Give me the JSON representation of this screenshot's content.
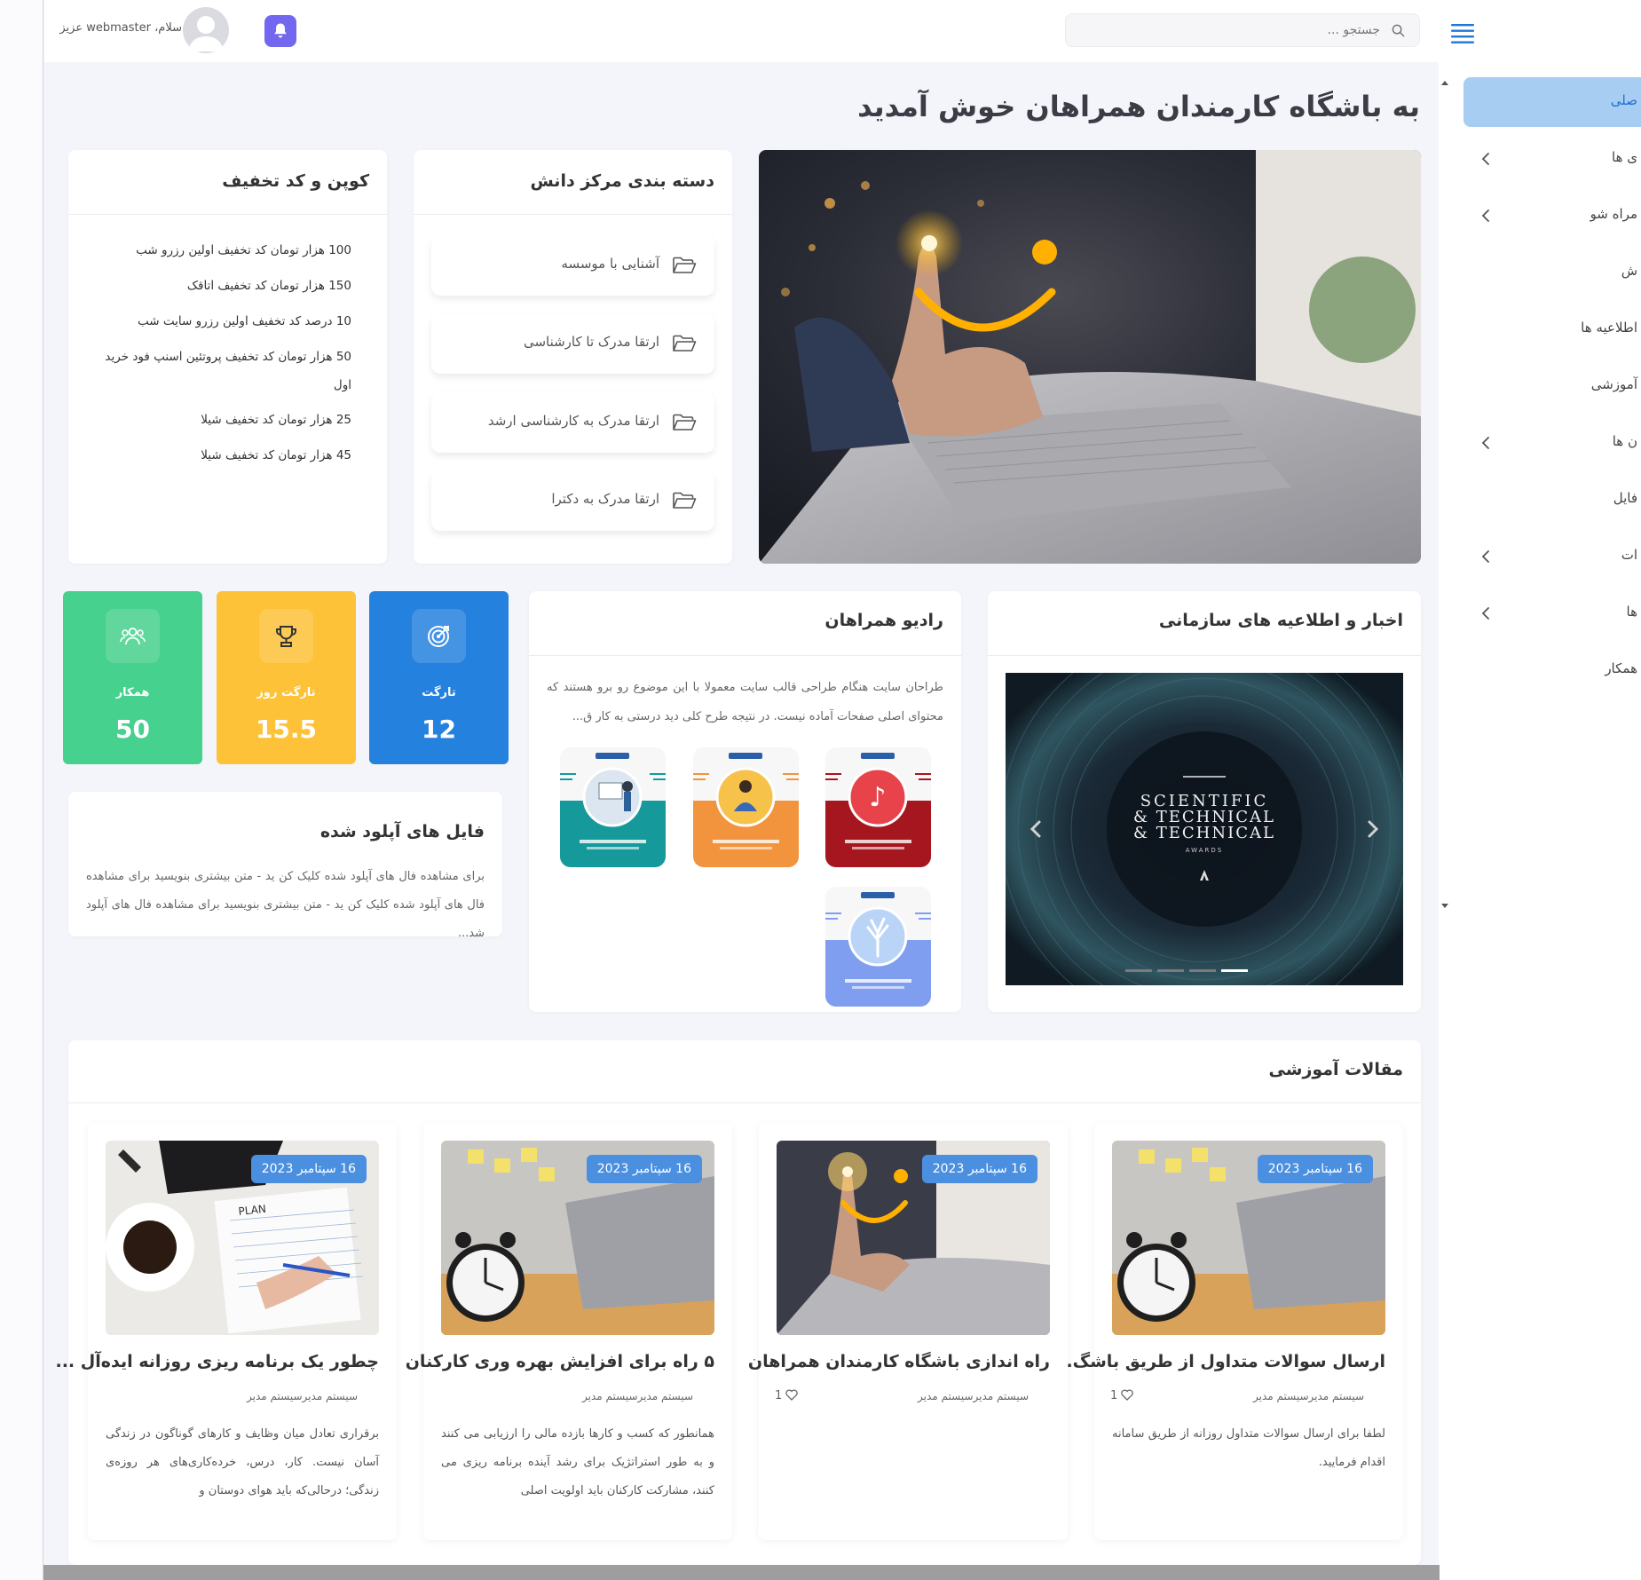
{
  "header": {
    "search_placeholder": "جستجو ...",
    "greeting": "سلام، webmaster عزیز"
  },
  "sidebar": {
    "items": [
      {
        "label": "صلی",
        "active": true,
        "has_chevron": false
      },
      {
        "label": "ی ها",
        "active": false,
        "has_chevron": true
      },
      {
        "label": "مراه شو",
        "active": false,
        "has_chevron": true
      },
      {
        "label": "ش",
        "active": false,
        "has_chevron": false
      },
      {
        "label": "اطلاعیه ها",
        "active": false,
        "has_chevron": false
      },
      {
        "label": "آموزشی",
        "active": false,
        "has_chevron": false
      },
      {
        "label": "ن ها",
        "active": false,
        "has_chevron": true
      },
      {
        "label": "فایل",
        "active": false,
        "has_chevron": false
      },
      {
        "label": "ات",
        "active": false,
        "has_chevron": true
      },
      {
        "label": "ها",
        "active": false,
        "has_chevron": true
      },
      {
        "label": "همکار",
        "active": false,
        "has_chevron": false
      }
    ]
  },
  "page": {
    "title": "به باشگاه کارمندان همراهان خوش آمدید"
  },
  "categories": {
    "title": "دسته بندی مرکز دانش",
    "items": [
      "آشنایی با موسسه",
      "ارتقا مدرک تا کارشناسی",
      "ارتقا مدرک به کارشناسی ارشد",
      "ارتقا مدرک به دکترا"
    ]
  },
  "coupons": {
    "title": "کوپن و کد تخفیف",
    "items": [
      "100 هزار تومان کد تخفیف اولین رزرو شب",
      "150 هزار تومان کد تخفیف اتاقک",
      "10 درصد کد تخفیف اولین رزرو سایت شب",
      "50 هزار تومان کد تخفیف پروتئین اسنپ فود خرید اول",
      "25 هزار تومان کد تخفیف شیلا",
      "45 هزار تومان کد تخفیف شیلا"
    ]
  },
  "news": {
    "title": "اخبار و اطلاعیه های سازمانی",
    "slide": {
      "line1": "SCIENTIFIC",
      "line2": "& TECHNICAL",
      "line3": "& TECHNICAL",
      "line4": "AWARDS"
    },
    "slide_count": 4,
    "active_slide": 4
  },
  "radio": {
    "title": "رادیو همراهان",
    "description": "طراحان سایت هنگام طراحی قالب سایت معمولا با این موضوع رو برو هستند که محتوای اصلی صفحات آماده نیست. در نتیجه طرح کلی دید درستی به کار ق..."
  },
  "stats": [
    {
      "label": "تارگت",
      "value": "12",
      "color": "#2581de",
      "icon": "target-icon"
    },
    {
      "label": "تارگت روز",
      "value": "15.5",
      "color": "#fdc238",
      "icon": "trophy-icon"
    },
    {
      "label": "همکار",
      "value": "50",
      "color": "#46d18e",
      "icon": "users-icon"
    }
  ],
  "uploaded": {
    "title": "فایل های آپلود شده",
    "description": "برای مشاهده فال های آپلود شده کلیک کن ید - متن بیشتری بنویسید برای مشاهده فال های آپلود شده کلیک کن ید - متن بیشتری بنویسید برای مشاهده فال های آپلود شد..."
  },
  "articles": {
    "title": "مقالات آموزشی",
    "items": [
      {
        "date": "16 سپتامبر 2023",
        "title": "ارسال سوالات متداول از طریق باشگ...",
        "author": "سیستم مدیرسیستم مدیر",
        "likes": "1",
        "description": "لطفا برای ارسال سوالات متداول روزانه از طریق سامانه اقدام فرمایید."
      },
      {
        "date": "16 سپتامبر 2023",
        "title": "راه اندازی باشگاه کارمندان همراهان",
        "author": "سیستم مدیرسیستم مدیر",
        "likes": "1",
        "description": ""
      },
      {
        "date": "16 سپتامبر 2023",
        "title": "۵ راه برای افزایش بهره وری کارکنان",
        "author": "سیستم مدیرسیستم مدیر",
        "likes": "",
        "description": "همانطور که کسب و کارها بازده مالی را ارزیابی می کنند و به طور استراتژیک برای رشد آینده برنامه ریزی می کنند، مشارکت کارکنان باید اولویت اصلی"
      },
      {
        "date": "16 سپتامبر 2023",
        "title": "چطور یک برنامه ریزی روزانه ایده‌آل ...",
        "author": "سیستم مدیرسیستم مدیر",
        "likes": "",
        "description": "برقراری تعادل میان وظایف و کارهای گوناگون در زندگی آسان نیست. کار، درس، خرده‌کاری‌های هر روزه‌ی زندگی؛ درحالی‌که باید هوای دوستان و"
      }
    ]
  }
}
